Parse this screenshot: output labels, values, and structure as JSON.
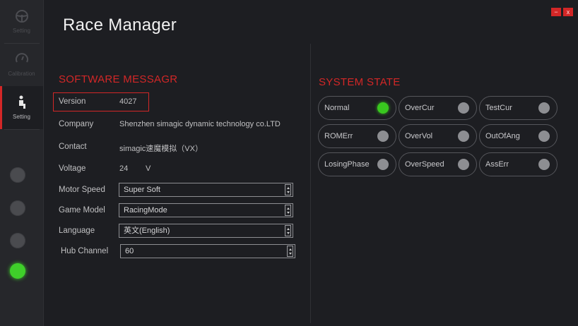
{
  "app": {
    "title": "Race Manager"
  },
  "window": {
    "minimize": "−",
    "close": "x"
  },
  "sidebar": {
    "items": [
      {
        "label": "Setting",
        "icon": "steering-wheel-icon",
        "active": false
      },
      {
        "label": "Calibration",
        "icon": "gauge-icon",
        "active": false
      },
      {
        "label": "Setting",
        "icon": "person-seat-icon",
        "active": true
      }
    ],
    "status_dots": [
      {
        "state": "off"
      },
      {
        "state": "off"
      },
      {
        "state": "off"
      },
      {
        "state": "on",
        "color": "#3fcf2a"
      }
    ]
  },
  "software": {
    "title": "SOFTWARE MESSAGR",
    "version_label": "Version",
    "version_value": "4027",
    "company_label": "Company",
    "company_value": "Shenzhen simagic dynamic technology co.LTD",
    "contact_label": "Contact",
    "contact_value": "simagic速魔模拟（VX）",
    "voltage_label": "Voltage",
    "voltage_value": "24",
    "voltage_unit": "V",
    "motor_speed_label": "Motor Speed",
    "motor_speed_value": "Super Soft",
    "game_model_label": "Game Model",
    "game_model_value": "RacingMode",
    "language_label": "Language",
    "language_value": "英文(English)",
    "hub_channel_label": "Hub Channel",
    "hub_channel_value": "60"
  },
  "system_state": {
    "title": "SYSTEM STATE",
    "items": [
      {
        "label": "Normal",
        "on": true
      },
      {
        "label": "OverCur",
        "on": false
      },
      {
        "label": "TestCur",
        "on": false
      },
      {
        "label": "ROMErr",
        "on": false
      },
      {
        "label": "OverVol",
        "on": false
      },
      {
        "label": "OutOfAng",
        "on": false
      },
      {
        "label": "LosingPhase",
        "on": false
      },
      {
        "label": "OverSpeed",
        "on": false
      },
      {
        "label": "AssErr",
        "on": false
      }
    ]
  },
  "colors": {
    "accent": "#d32727",
    "ok": "#3fcf2a",
    "background": "#1d1e22"
  }
}
